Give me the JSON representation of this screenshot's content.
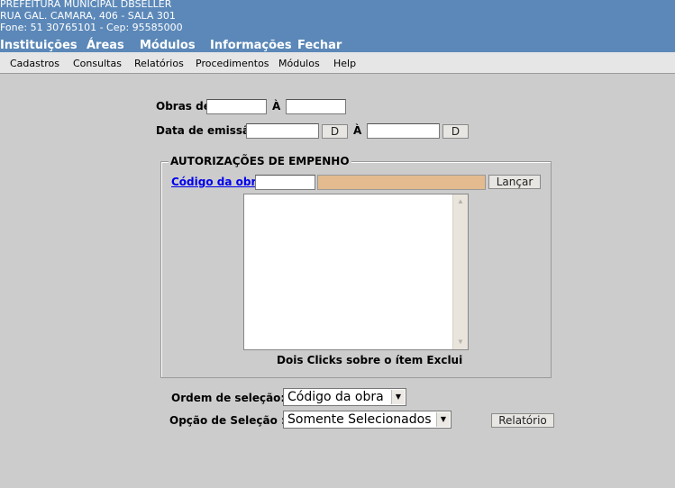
{
  "header": {
    "org_name": "PREFEITURA MUNICIPAL DBSELLER",
    "address": "RUA GAL. CAMARA, 406 - SALA 301",
    "contact": "Fone: 51 30765101  -  Cep: 95585000",
    "bg_color": "#5b88b8"
  },
  "main_menu": [
    "Instituições",
    "Áreas",
    "Módulos",
    "Informações",
    "Fechar"
  ],
  "sub_menu": [
    "Cadastros",
    "Consultas",
    "Relatórios",
    "Procedimentos",
    "Módulos",
    "Help"
  ],
  "form": {
    "obras_label": "Obras de",
    "obras_ate": "À",
    "obras_from_value": "",
    "obras_to_value": "",
    "data_label": "Data de emissão",
    "data_ate": "À",
    "data_from_value": "",
    "data_to_value": "",
    "date_button_label": "D"
  },
  "fieldset": {
    "legend": "AUTORIZAÇÕES DE EMPENHO",
    "codigo_link": "Código da obra:",
    "codigo_value": "",
    "lancar_button": "Lançar",
    "list_items": [],
    "hint": "Dois Clicks sobre o ítem Exclui"
  },
  "ordem": {
    "label": "Ordem de seleção:",
    "selected": "Código da obra"
  },
  "opcao": {
    "label": "Opção de Seleção :",
    "selected": "Somente Selecionados"
  },
  "relatorio_button": "Relatório"
}
